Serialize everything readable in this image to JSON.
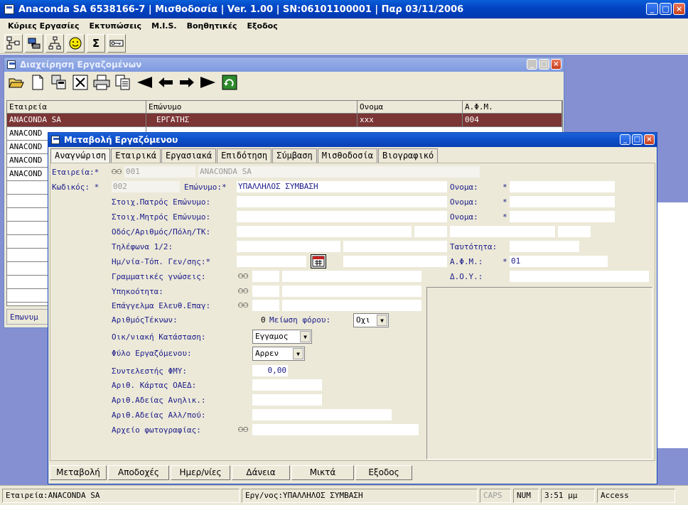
{
  "app": {
    "title": "Anaconda SA 6538166-7 | Μισθοδοσία | Ver. 1.00 | SN:06101100001 | Παρ 03/11/2006"
  },
  "menu": [
    "Κύριες Εργασίες",
    "Εκτυπώσεις",
    "M.I.S.",
    "Βοηθητικές",
    "Εξοδος"
  ],
  "app_toolbar_icons": [
    "org-chart-icon",
    "network-icon",
    "tree-icon",
    "smiley-icon",
    "sigma-icon",
    "key-icon"
  ],
  "back_window": {
    "title": "Διαχείρηση Εργαζομένων",
    "columns": [
      "Εταιρεία",
      "Επώνυμο",
      "Ονομα",
      "Α.Φ.Μ."
    ],
    "rows": [
      [
        "ANACONDA SA",
        "ΕΡΓΑΤΗΣ",
        "xxx",
        "004"
      ],
      [
        "ANACOND",
        "",
        "",
        ""
      ],
      [
        "ANACOND",
        "",
        "",
        ""
      ],
      [
        "ANACOND",
        "",
        "",
        ""
      ],
      [
        "ANACOND",
        "",
        "",
        ""
      ]
    ],
    "status_label": "Επωνυμ"
  },
  "front_window": {
    "title": "Μεταβολή Εργαζόμενου",
    "tabs": [
      "Αναγνώριση",
      "Εταιρικά",
      "Εργασιακά",
      "Επιδότηση",
      "Σύμβαση",
      "Μισθοδοσία",
      "Βιογραφικό"
    ],
    "labels": {
      "company": "Εταιρεία:*",
      "code": "Κωδικός: *",
      "surname": "Επώνυμο:*",
      "name1": "Ονομα:",
      "father": "Στοιχ.Πατρός Επώνυμο:",
      "name2": "Ονομα:",
      "mother": "Στοιχ.Μητρός Επώνυμο:",
      "name3": "Ονομα:",
      "address": "Οδός/Αριθμός/Πόλη/ΤΚ:",
      "phones": "Τηλέφωνα 1/2:",
      "id_card": "Ταυτότητα:",
      "birth": "Ημ/νία-Τόπ. Γεν/σης:*",
      "afm": "Α.Φ.Μ.:",
      "letters": "Γραμματικές γνώσεις:",
      "doy": "Δ.Ο.Υ.:",
      "citizenship": "Υπηκοότητα:",
      "profession": "Επάγγελμα Ελευθ.Επαγ:",
      "children": "ΑριθμόςΤέκνων:",
      "tax_reduction": "Μείωση φόρου:",
      "marital": "Οικ/νιακή Κατάσταση:",
      "gender": "Φύλο Εργαζόμενου:",
      "fmy": "Συντελεστής ΦΜΥ:",
      "oaed": "Αριθ. Κάρτας ΟΑΕΔ:",
      "minor_permit": "Αριθ.Αδείας Ανηλικ.:",
      "foreign_permit": "Αριθ.Αδείας Αλλ/πού:",
      "photo": "Αρχείο φωτογραφίας:"
    },
    "star": "*",
    "values": {
      "company_code": "001",
      "company_name": "ANACONDA SA",
      "code": "002",
      "surname": "ΥΠΑΛΛΗΛΟΣ ΣΥΜΒΑΣΗ",
      "afm": "01",
      "children": "0",
      "tax_reduction": "Οχι",
      "marital": "Εγγαμος",
      "gender": "Αρρεν",
      "fmy": "0,00"
    },
    "buttons": [
      "Μεταβολή",
      "Αποδοχές",
      "Ημερ/νίες",
      "Δάνεια",
      "Μικτά",
      "Εξοδος"
    ]
  },
  "statusbar": {
    "company": "Εταιρεία:ANACONDA SA",
    "employee": "Εργ/νος:ΥΠΑΛΛΗΛΟΣ ΣΥΜΒΑΣΗ",
    "caps": "CAPS",
    "num": "NUM",
    "time": "3:51 μμ",
    "app": "Access"
  }
}
